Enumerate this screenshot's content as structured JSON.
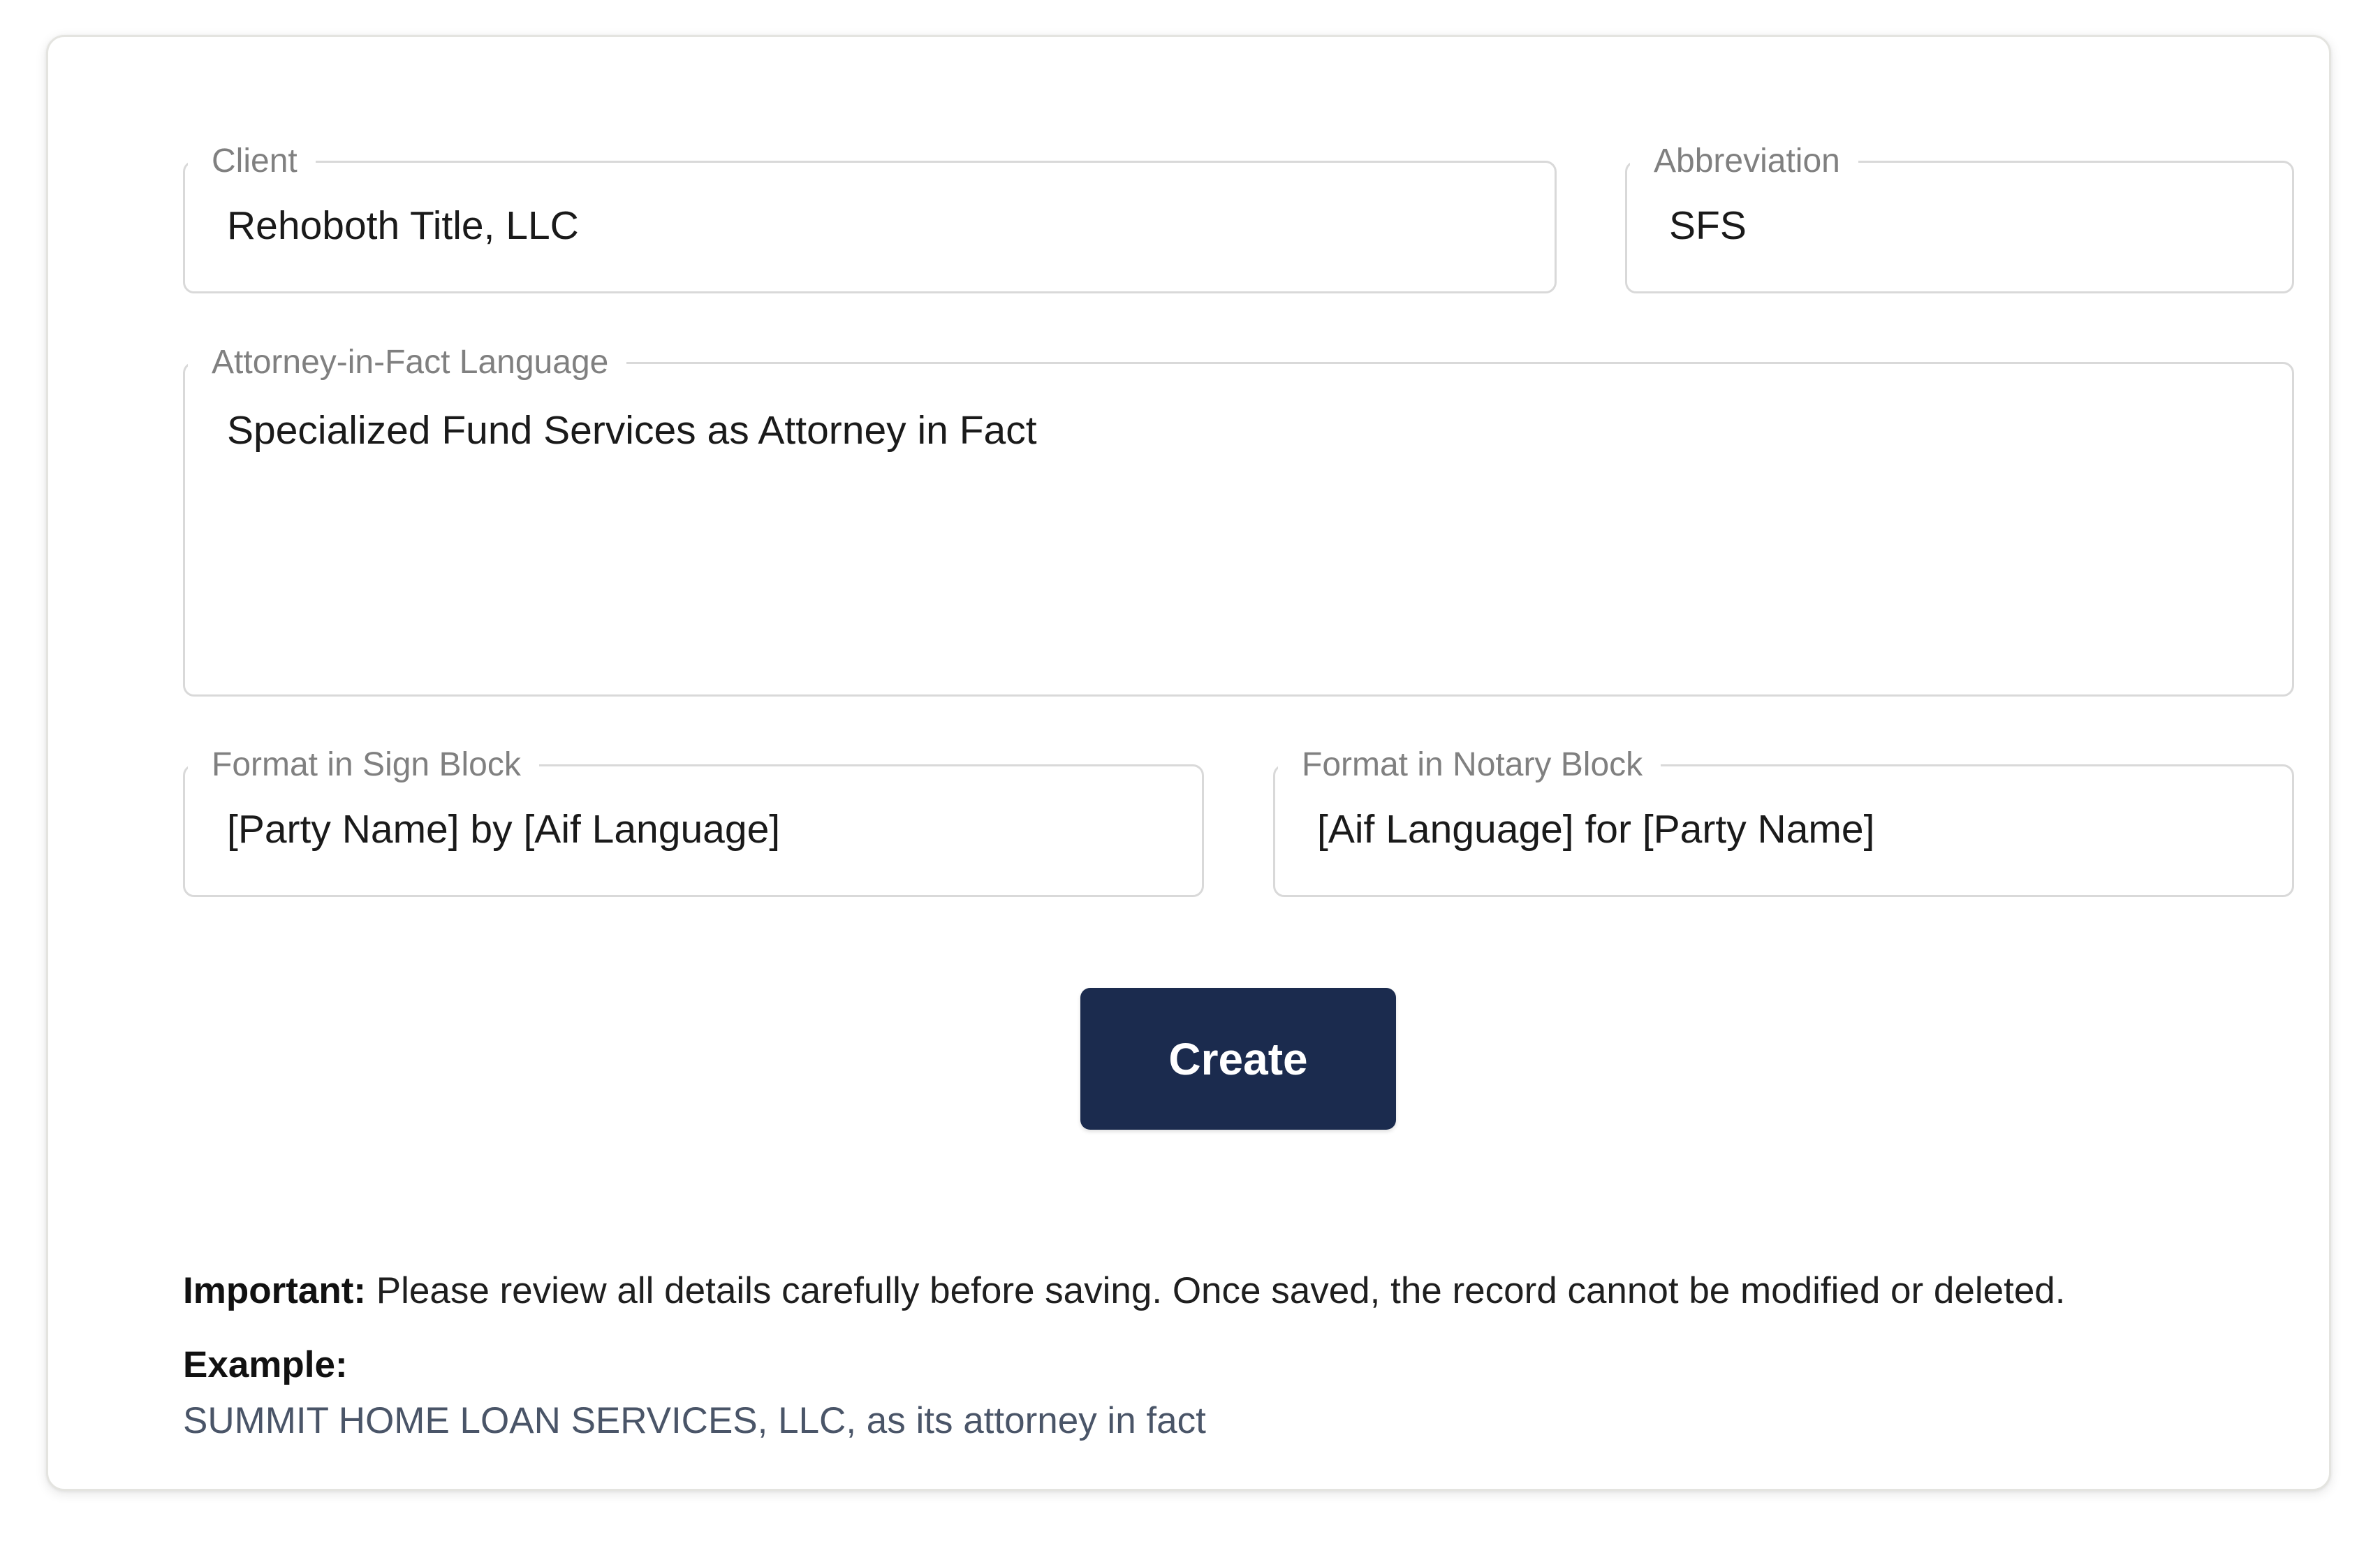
{
  "form": {
    "client": {
      "label": "Client",
      "value": "Rehoboth Title, LLC"
    },
    "abbreviation": {
      "label": "Abbreviation",
      "value": "SFS"
    },
    "aif_language": {
      "label": "Attorney-in-Fact Language",
      "value": "Specialized Fund Services as Attorney in Fact"
    },
    "sign_block": {
      "label": "Format in Sign Block",
      "value": "[Party Name] by [Aif Language]"
    },
    "notary_block": {
      "label": "Format in Notary Block",
      "value": "[Aif Language] for [Party Name]"
    },
    "create_label": "Create"
  },
  "notice": {
    "important_label": "Important:",
    "important_text": " Please review all details carefully before saving. Once saved, the record cannot be modified or deleted.",
    "example_label": "Example:",
    "example_text": "SUMMIT HOME LOAN SERVICES, LLC, as its attorney in fact"
  }
}
